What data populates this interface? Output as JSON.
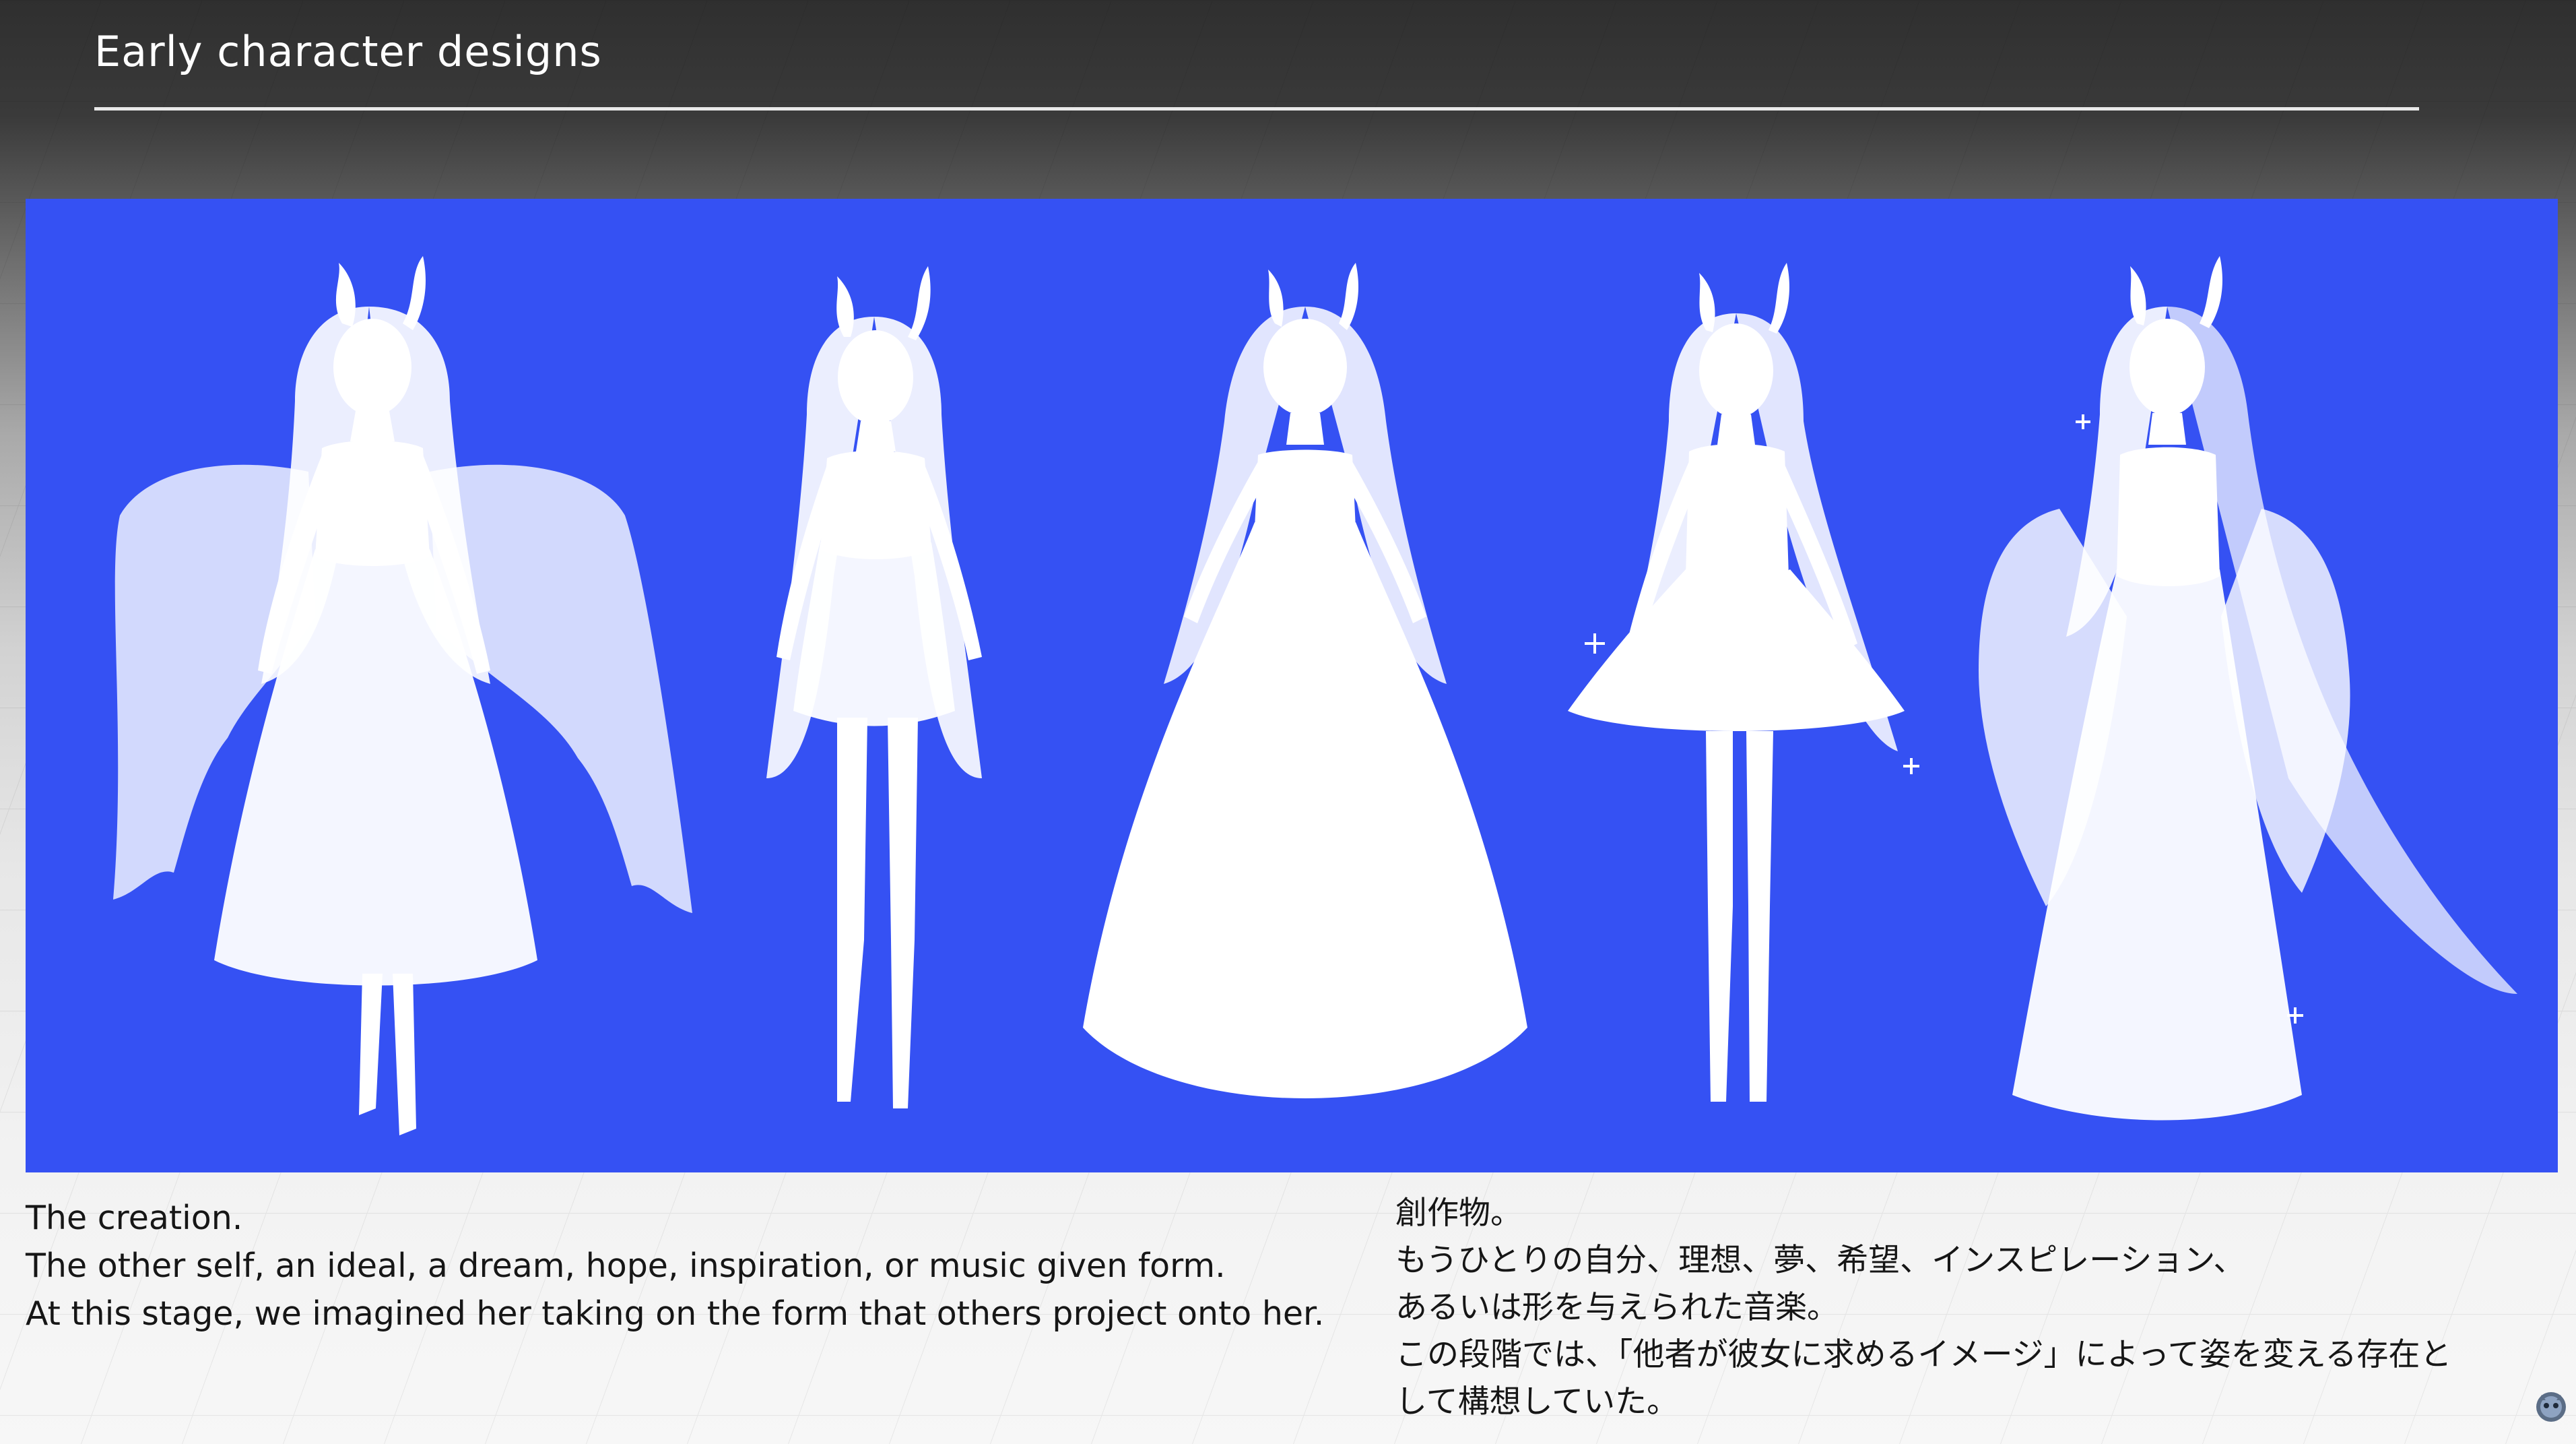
{
  "slide": {
    "title": "Early character designs"
  },
  "caption_en": {
    "line1": "The creation.",
    "line2": "The other self, an ideal, a dream, hope, inspiration, or music given form.",
    "line3": "At this stage, we imagined her taking on the form that others project onto her."
  },
  "caption_ja": {
    "line1": "創作物。",
    "line2": " もうひとりの自分、理想、夢、希望、インスピレーション、",
    "line3": "あるいは形を与えられた音楽。",
    "line4": " この段階では、「他者が彼女に求めるイメージ」によって姿を変える存在と",
    "line5": "して構想していた。"
  },
  "artwork": {
    "background_color": "#3551f3",
    "figure_color": "#ffffff",
    "figures": [
      "winged-figure",
      "short-dress-figure",
      "ballgown-figure",
      "frilled-skirt-figure",
      "fur-cloak-figure"
    ]
  },
  "icons": {
    "corner": "assistant-bot-icon"
  }
}
